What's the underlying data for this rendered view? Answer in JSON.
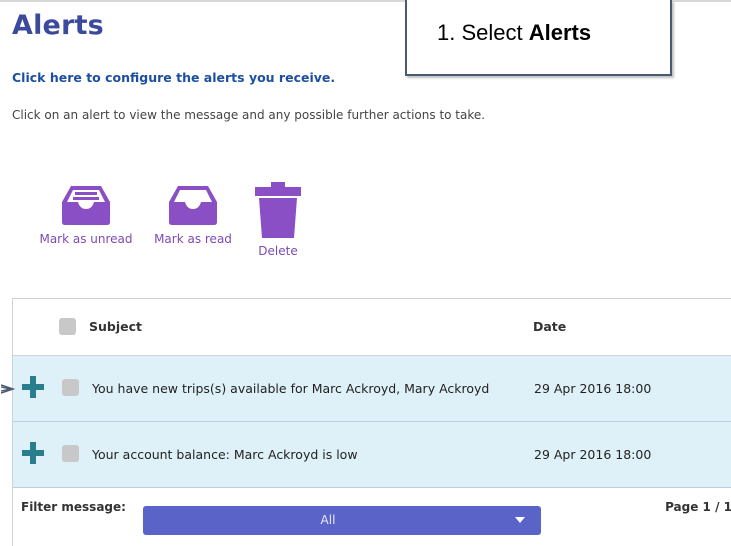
{
  "page": {
    "title": "Alerts",
    "config_link": "Click here to configure the alerts you receive.",
    "instructions": "Click on an alert to view the message and any possible further actions to take."
  },
  "callout": {
    "prefix": "1. Select ",
    "emphasis": "Alerts"
  },
  "actions": {
    "mark_unread": {
      "label": "Mark as unread",
      "icon": "inbox-full-icon"
    },
    "mark_read": {
      "label": "Mark as read",
      "icon": "inbox-empty-icon"
    },
    "delete": {
      "label": "Delete",
      "icon": "trash-icon"
    }
  },
  "table": {
    "headers": {
      "subject": "Subject",
      "date": "Date"
    },
    "rows": [
      {
        "subject": "You have new trips(s) available for Marc Ackroyd, Mary Ackroyd",
        "date": "29 Apr 2016 18:00"
      },
      {
        "subject": "Your account balance: Marc Ackroyd is low",
        "date": "29 Apr 2016 18:00"
      }
    ]
  },
  "footer": {
    "filter_label": "Filter message:",
    "filter_value": "All",
    "page_info": "Page 1 / 1"
  },
  "colors": {
    "title": "#3b4a9c",
    "accent_purple": "#7b4bb3",
    "row_highlight": "#dff1f8",
    "expand_icon": "#2a7d8c",
    "select_bg": "#5a63c8"
  }
}
